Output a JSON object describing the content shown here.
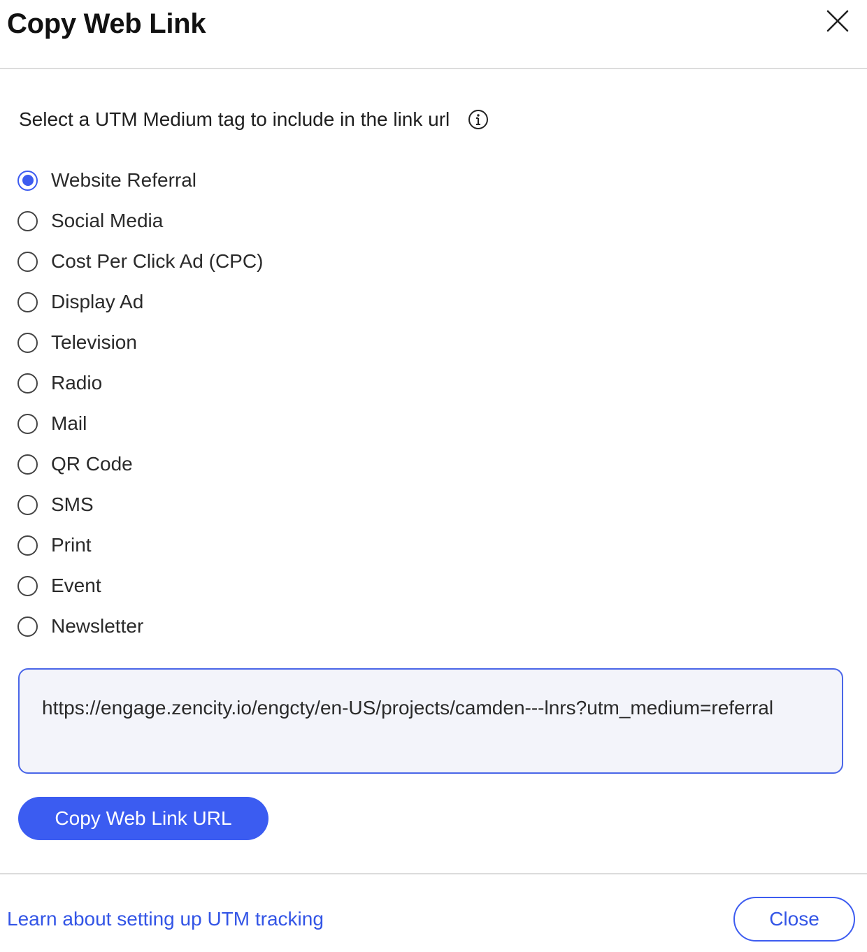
{
  "dialog": {
    "title": "Copy Web Link",
    "close_icon": "close-icon"
  },
  "utm": {
    "prompt": "Select a UTM Medium tag to include in the link url",
    "info_icon": "info-icon",
    "options": [
      {
        "label": "Website Referral",
        "checked": true
      },
      {
        "label": "Social Media",
        "checked": false
      },
      {
        "label": "Cost Per Click Ad (CPC)",
        "checked": false
      },
      {
        "label": "Display Ad",
        "checked": false
      },
      {
        "label": "Television",
        "checked": false
      },
      {
        "label": "Radio",
        "checked": false
      },
      {
        "label": "Mail",
        "checked": false
      },
      {
        "label": "QR Code",
        "checked": false
      },
      {
        "label": "SMS",
        "checked": false
      },
      {
        "label": "Print",
        "checked": false
      },
      {
        "label": "Event",
        "checked": false
      },
      {
        "label": "Newsletter",
        "checked": false
      }
    ]
  },
  "link": {
    "url": "https://engage.zencity.io/engcty/en-US/projects/camden---lnrs?utm_medium=referral"
  },
  "actions": {
    "copy_label": "Copy Web Link URL",
    "learn_label": "Learn about setting up UTM tracking",
    "close_label": "Close"
  },
  "colors": {
    "accent": "#3b5cf1",
    "url_box_bg": "#f3f4fa"
  }
}
